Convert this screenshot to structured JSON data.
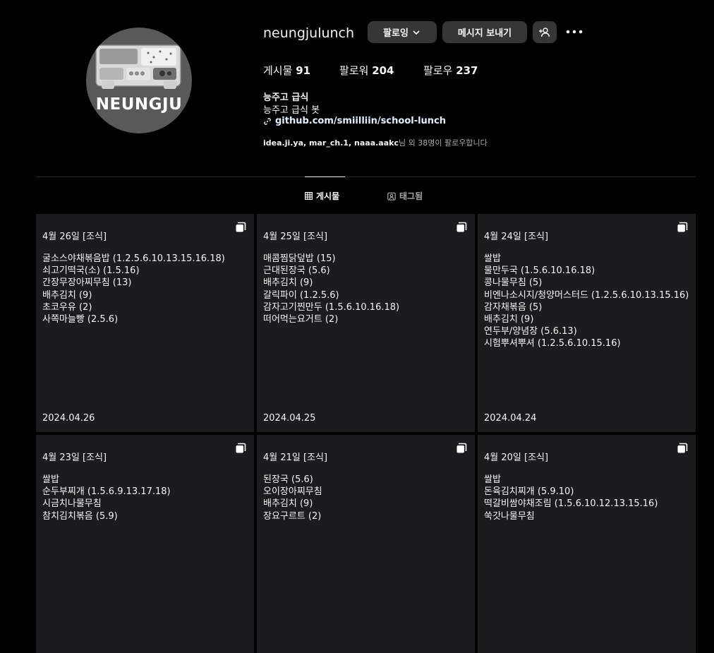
{
  "profile": {
    "avatar_text": "NEUNGJU",
    "username": "neungjulunch",
    "buttons": {
      "following": "팔로잉",
      "message": "메시지 보내기"
    },
    "stats": {
      "posts_label": "게시물",
      "posts_count": "91",
      "followers_label": "팔로워",
      "followers_count": "204",
      "following_label": "팔로우",
      "following_count": "237"
    },
    "bio": {
      "name": "능주고 급식",
      "description": "능주고 급식 봇",
      "link": "github.com/smiilliin/school-lunch"
    },
    "followed_by": {
      "names": "idea.ji.ya, mar_ch.1, naaa.aakc",
      "suffix": "님 외 38명이 팔로우합니다"
    }
  },
  "tabs": {
    "posts": "게시물",
    "tagged": "태그됨"
  },
  "icons": [
    "chevron-down-icon",
    "add-user-icon",
    "more-icon",
    "link-icon",
    "grid-icon",
    "tagged-icon",
    "multiple-posts-icon"
  ],
  "posts": [
    {
      "title": "4월 26일 [조식]",
      "items": [
        "굴소스야채볶음밥 (1.2.5.6.10.13.15.16.18)",
        "쇠고기떡국(소) (1.5.16)",
        "간장무장아찌무침 (13)",
        "배추김치 (9)",
        "초코우유 (2)",
        "사쪽마늘빵 (2.5.6)"
      ],
      "date": "2024.04.26"
    },
    {
      "title": "4월 25일 [조식]",
      "items": [
        "매콤찜닭덮밥 (15)",
        "근대된장국 (5.6)",
        "배추김치 (9)",
        "갈릭파이 (1.2.5.6)",
        "감자고기찐만두 (1.5.6.10.16.18)",
        "떠어먹는요거트 (2)"
      ],
      "date": "2024.04.25"
    },
    {
      "title": "4월 24일 [조식]",
      "items": [
        "쌀밥",
        "물만두국 (1.5.6.10.16.18)",
        "콩나물무침 (5)",
        "비엔나소시지/청양머스터드 (1.2.5.6.10.13.15.16)",
        "감자채볶음 (5)",
        "배추김치 (9)",
        "연두부/양념장 (5.6.13)",
        "시험뿌셔뿌셔 (1.2.5.6.10.15.16)"
      ],
      "date": "2024.04.24"
    },
    {
      "title": "4월 23일 [조식]",
      "items": [
        "쌀밥",
        "순두부찌개 (1.5.6.9.13.17.18)",
        "시금치나물무침",
        "참치김치볶음 (5.9)"
      ],
      "date": ""
    },
    {
      "title": "4월 21일 [조식]",
      "items": [
        "된장국 (5.6)",
        "오이장아찌무침",
        "배추김치 (9)",
        "장요구르트 (2)"
      ],
      "date": ""
    },
    {
      "title": "4월 20일 [조식]",
      "items": [
        "쌀밥",
        "돈육김치찌개 (5.9.10)",
        "떡갈비쌈야채조림 (1.5.6.10.12.13.15.16)",
        "쑥갓나물무침"
      ],
      "date": ""
    }
  ]
}
